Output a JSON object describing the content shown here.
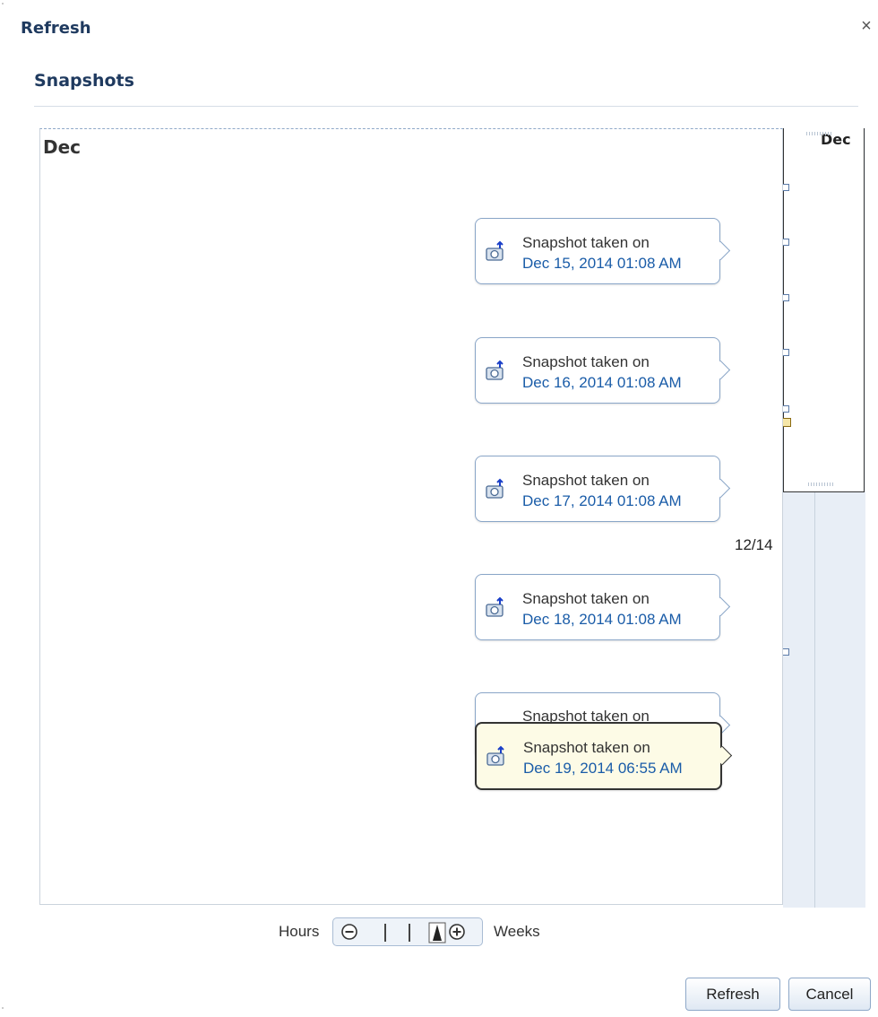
{
  "dialog": {
    "title": "Refresh",
    "close_glyph": "×"
  },
  "section": {
    "title": "Snapshots"
  },
  "timeline": {
    "month_label": "Dec",
    "date_label": "12/14",
    "snapshots": [
      {
        "line1": "Snapshot taken on",
        "line2": "Dec 15, 2014 01:08 AM"
      },
      {
        "line1": "Snapshot taken on",
        "line2": "Dec 16, 2014 01:08 AM"
      },
      {
        "line1": "Snapshot taken on",
        "line2": "Dec 17, 2014 01:08 AM"
      },
      {
        "line1": "Snapshot taken on",
        "line2": "Dec 18, 2014 01:08 AM"
      },
      {
        "line1": "Snapshot taken on",
        "line2": "Dec 19, 2014 06:55 AM"
      }
    ],
    "selected_snapshot": "Dec 19, 2014 06:55 AM",
    "icon": "camera-snapshot-icon"
  },
  "overview": {
    "month_label": "Dec"
  },
  "zoom": {
    "min_label": "Hours",
    "max_label": "Weeks",
    "zoom_out_icon": "zoom-out-icon",
    "zoom_in_icon": "zoom-in-icon"
  },
  "buttons": {
    "refresh": "Refresh",
    "cancel": "Cancel"
  },
  "colors": {
    "heading": "#1f3a5f",
    "link": "#1a5ca8",
    "selected_bg": "#fdfbe6"
  }
}
